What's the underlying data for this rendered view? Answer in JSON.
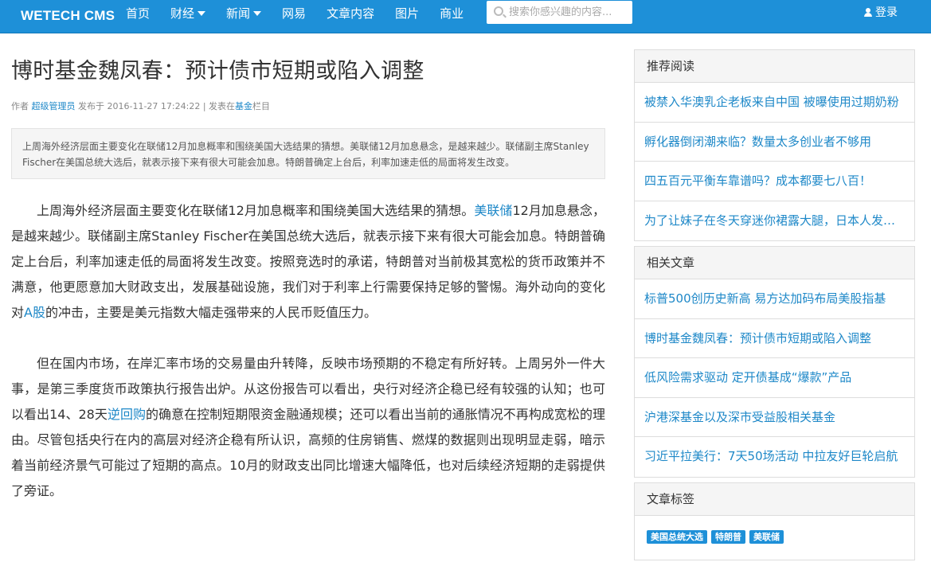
{
  "header": {
    "brand": "WETECH CMS",
    "nav": [
      {
        "label": "首页",
        "dropdown": false
      },
      {
        "label": "财经",
        "dropdown": true
      },
      {
        "label": "新闻",
        "dropdown": true
      },
      {
        "label": "网易",
        "dropdown": false
      },
      {
        "label": "文章内容",
        "dropdown": false
      },
      {
        "label": "图片",
        "dropdown": false
      },
      {
        "label": "商业",
        "dropdown": false
      }
    ],
    "search_placeholder": "搜索你感兴趣的内容...",
    "login_label": "登录"
  },
  "article": {
    "title": "博时基金魏凤春：预计债市短期或陷入调整",
    "meta": {
      "author_prefix": "作者",
      "author": "超级管理员",
      "published_prefix": "发布于",
      "published": "2016-11-27 17:24:22",
      "column_prefix": "| 发表在",
      "column": "基金",
      "column_suffix": "栏目"
    },
    "summary": "上周海外经济层面主要变化在联储12月加息概率和围绕美国大选结果的猜想。美联储12月加息悬念，是越来越少。联储副主席Stanley Fischer在美国总统大选后，就表示接下来有很大可能会加息。特朗普确定上台后，利率加速走低的局面将发生改变。",
    "p1": {
      "a": "上周海外经济层面主要变化在联储12月加息概率和围绕美国大选结果的猜想。",
      "link1": "美联储",
      "b": "12月加息悬念，是越来越少。联储副主席Stanley Fischer在美国总统大选后，就表示接下来有很大可能会加息。特朗普确定上台后，利率加速走低的局面将发生改变。按照竞选时的承诺，特朗普对当前极其宽松的货币政策并不满意，他更愿意加大财政支出，发展基础设施，我们对于利率上行需要保持足够的警惕。海外动向的变化对",
      "link2": "A股",
      "c": "的冲击，主要是美元指数大幅走强带来的人民币贬值压力。"
    },
    "p2": {
      "a": "但在国内市场，在岸汇率市场的交易量由升转降，反映市场预期的不稳定有所好转。上周另外一件大事，是第三季度货币政策执行报告出炉。从这份报告可以看出，央行对经济企稳已经有较强的认知；也可以看出14、28天",
      "link1": "逆回购",
      "b": "的确意在控制短期限资金融通规模；还可以看出当前的通胀情况不再构成宽松的理由。尽管包括央行在内的高层对经济企稳有所认识，高频的住房销售、燃煤的数据则出现明显走弱，暗示着当前经济景气可能过了短期的高点。10月的财政支出同比增速大幅降低，也对后续经济短期的走弱提供了旁证。"
    }
  },
  "sidebar": {
    "recommended": {
      "heading": "推荐阅读",
      "items": [
        "被禁入华澳乳企老板来自中国 被曝使用过期奶粉",
        "孵化器倒闭潮来临？数量太多创业者不够用",
        "四五百元平衡车靠谱吗？成本都要七八百！",
        "为了让妹子在冬天穿迷你裙露大腿，日本人发明了"
      ]
    },
    "related": {
      "heading": "相关文章",
      "items": [
        "标普500创历史新高 易方达加码布局美股指基",
        "博时基金魏凤春：预计债市短期或陷入调整",
        "低风险需求驱动 定开债基成“爆款”产品",
        "沪港深基金以及深市受益股相关基金",
        "习近平拉美行：7天50场活动 中拉友好巨轮启航"
      ]
    },
    "tags": {
      "heading": "文章标签",
      "items": [
        "美国总统大选",
        "特朗普",
        "美联储"
      ]
    }
  },
  "colors": {
    "navbar": "#1e90d8",
    "link": "#1e88c8",
    "panel_head_bg": "#f5f5f5"
  }
}
